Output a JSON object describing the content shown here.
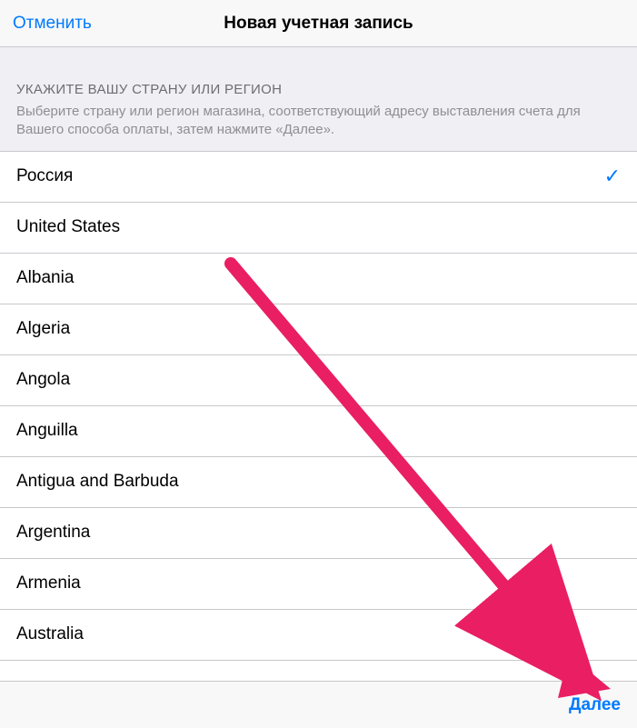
{
  "nav": {
    "cancel": "Отменить",
    "title": "Новая учетная запись"
  },
  "section": {
    "title": "УКАЖИТЕ ВАШУ СТРАНУ ИЛИ РЕГИОН",
    "description": "Выберите страну или регион магазина, соответствующий адресу выставления счета для Вашего способа оплаты, затем нажмите «Далее»."
  },
  "countries": [
    {
      "label": "Россия",
      "selected": true
    },
    {
      "label": "United States",
      "selected": false
    },
    {
      "label": "Albania",
      "selected": false
    },
    {
      "label": "Algeria",
      "selected": false
    },
    {
      "label": "Angola",
      "selected": false
    },
    {
      "label": "Anguilla",
      "selected": false
    },
    {
      "label": "Antigua and Barbuda",
      "selected": false
    },
    {
      "label": "Argentina",
      "selected": false
    },
    {
      "label": "Armenia",
      "selected": false
    },
    {
      "label": "Australia",
      "selected": false
    }
  ],
  "bottom": {
    "next": "Далее"
  },
  "annotation": {
    "arrow_color": "#e91e63"
  }
}
